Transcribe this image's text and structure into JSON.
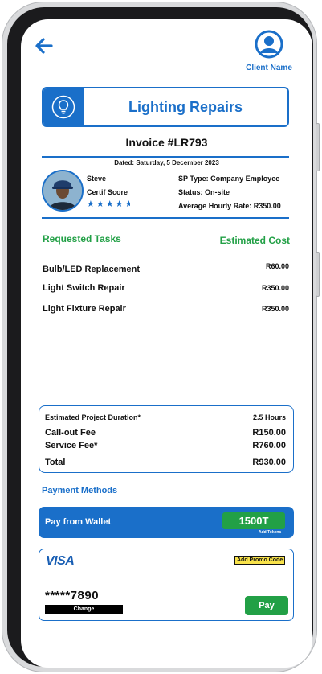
{
  "header": {
    "client_label": "Client Name"
  },
  "service": {
    "title": "Lighting Repairs",
    "invoice": "Invoice #LR793",
    "dated": "Dated: Saturday, 5 December 2023"
  },
  "provider": {
    "name": "Steve",
    "certif_label": "Certif Score",
    "rating_stars": 4.5,
    "sp_type": "SP Type: Company Employee",
    "status": "Status: On-site",
    "hourly_rate": "Average Hourly Rate: R350.00"
  },
  "tasks": {
    "head_tasks": "Requested Tasks",
    "head_cost": "Estimated Cost",
    "items": [
      {
        "name": "Bulb/LED Replacement",
        "cost": "R60.00"
      },
      {
        "name": "Light Switch Repair",
        "cost": "R350.00"
      },
      {
        "name": "Light Fixture Repair",
        "cost": "R350.00"
      }
    ]
  },
  "summary": {
    "duration_label": "Estimated Project Duration*",
    "duration_value": "2.5 Hours",
    "callout_label": "Call-out Fee",
    "callout_value": "R150.00",
    "service_label": "Service Fee*",
    "service_value": "R760.00",
    "total_label": "Total",
    "total_value": "R930.00"
  },
  "payment": {
    "head": "Payment Methods",
    "wallet_label": "Pay from Wallet",
    "wallet_balance": "1500T",
    "add_tokens": "Add Tokens",
    "card_brand": "VISA",
    "promo": "Add Promo Code",
    "card_number": "*****7890",
    "change": "Change",
    "pay": "Pay"
  },
  "colors": {
    "brand_blue": "#1a6fc9",
    "success_green": "#22a046",
    "promo_yellow": "#f8e24a"
  },
  "icons": [
    "back-arrow-icon",
    "user-icon",
    "lightbulb-icon",
    "star-icon"
  ]
}
